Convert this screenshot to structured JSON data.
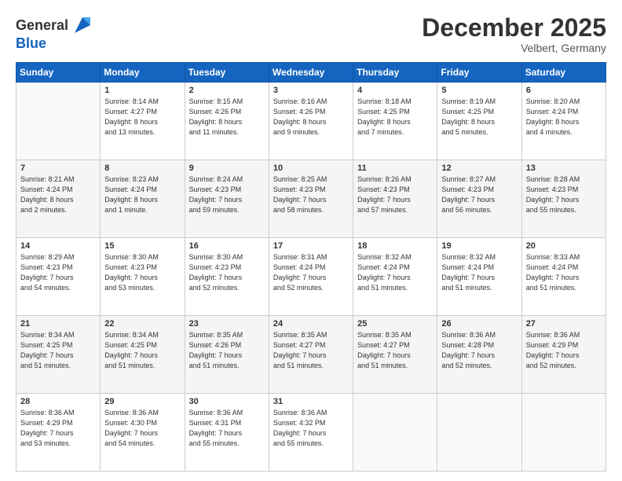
{
  "header": {
    "logo_general": "General",
    "logo_blue": "Blue",
    "month_title": "December 2025",
    "location": "Velbert, Germany"
  },
  "days_of_week": [
    "Sunday",
    "Monday",
    "Tuesday",
    "Wednesday",
    "Thursday",
    "Friday",
    "Saturday"
  ],
  "weeks": [
    [
      {
        "day": "",
        "info": ""
      },
      {
        "day": "1",
        "info": "Sunrise: 8:14 AM\nSunset: 4:27 PM\nDaylight: 8 hours\nand 13 minutes."
      },
      {
        "day": "2",
        "info": "Sunrise: 8:15 AM\nSunset: 4:26 PM\nDaylight: 8 hours\nand 11 minutes."
      },
      {
        "day": "3",
        "info": "Sunrise: 8:16 AM\nSunset: 4:26 PM\nDaylight: 8 hours\nand 9 minutes."
      },
      {
        "day": "4",
        "info": "Sunrise: 8:18 AM\nSunset: 4:25 PM\nDaylight: 8 hours\nand 7 minutes."
      },
      {
        "day": "5",
        "info": "Sunrise: 8:19 AM\nSunset: 4:25 PM\nDaylight: 8 hours\nand 5 minutes."
      },
      {
        "day": "6",
        "info": "Sunrise: 8:20 AM\nSunset: 4:24 PM\nDaylight: 8 hours\nand 4 minutes."
      }
    ],
    [
      {
        "day": "7",
        "info": "Sunrise: 8:21 AM\nSunset: 4:24 PM\nDaylight: 8 hours\nand 2 minutes."
      },
      {
        "day": "8",
        "info": "Sunrise: 8:23 AM\nSunset: 4:24 PM\nDaylight: 8 hours\nand 1 minute."
      },
      {
        "day": "9",
        "info": "Sunrise: 8:24 AM\nSunset: 4:23 PM\nDaylight: 7 hours\nand 59 minutes."
      },
      {
        "day": "10",
        "info": "Sunrise: 8:25 AM\nSunset: 4:23 PM\nDaylight: 7 hours\nand 58 minutes."
      },
      {
        "day": "11",
        "info": "Sunrise: 8:26 AM\nSunset: 4:23 PM\nDaylight: 7 hours\nand 57 minutes."
      },
      {
        "day": "12",
        "info": "Sunrise: 8:27 AM\nSunset: 4:23 PM\nDaylight: 7 hours\nand 56 minutes."
      },
      {
        "day": "13",
        "info": "Sunrise: 8:28 AM\nSunset: 4:23 PM\nDaylight: 7 hours\nand 55 minutes."
      }
    ],
    [
      {
        "day": "14",
        "info": "Sunrise: 8:29 AM\nSunset: 4:23 PM\nDaylight: 7 hours\nand 54 minutes."
      },
      {
        "day": "15",
        "info": "Sunrise: 8:30 AM\nSunset: 4:23 PM\nDaylight: 7 hours\nand 53 minutes."
      },
      {
        "day": "16",
        "info": "Sunrise: 8:30 AM\nSunset: 4:23 PM\nDaylight: 7 hours\nand 52 minutes."
      },
      {
        "day": "17",
        "info": "Sunrise: 8:31 AM\nSunset: 4:24 PM\nDaylight: 7 hours\nand 52 minutes."
      },
      {
        "day": "18",
        "info": "Sunrise: 8:32 AM\nSunset: 4:24 PM\nDaylight: 7 hours\nand 51 minutes."
      },
      {
        "day": "19",
        "info": "Sunrise: 8:32 AM\nSunset: 4:24 PM\nDaylight: 7 hours\nand 51 minutes."
      },
      {
        "day": "20",
        "info": "Sunrise: 8:33 AM\nSunset: 4:24 PM\nDaylight: 7 hours\nand 51 minutes."
      }
    ],
    [
      {
        "day": "21",
        "info": "Sunrise: 8:34 AM\nSunset: 4:25 PM\nDaylight: 7 hours\nand 51 minutes."
      },
      {
        "day": "22",
        "info": "Sunrise: 8:34 AM\nSunset: 4:25 PM\nDaylight: 7 hours\nand 51 minutes."
      },
      {
        "day": "23",
        "info": "Sunrise: 8:35 AM\nSunset: 4:26 PM\nDaylight: 7 hours\nand 51 minutes."
      },
      {
        "day": "24",
        "info": "Sunrise: 8:35 AM\nSunset: 4:27 PM\nDaylight: 7 hours\nand 51 minutes."
      },
      {
        "day": "25",
        "info": "Sunrise: 8:35 AM\nSunset: 4:27 PM\nDaylight: 7 hours\nand 51 minutes."
      },
      {
        "day": "26",
        "info": "Sunrise: 8:36 AM\nSunset: 4:28 PM\nDaylight: 7 hours\nand 52 minutes."
      },
      {
        "day": "27",
        "info": "Sunrise: 8:36 AM\nSunset: 4:29 PM\nDaylight: 7 hours\nand 52 minutes."
      }
    ],
    [
      {
        "day": "28",
        "info": "Sunrise: 8:36 AM\nSunset: 4:29 PM\nDaylight: 7 hours\nand 53 minutes."
      },
      {
        "day": "29",
        "info": "Sunrise: 8:36 AM\nSunset: 4:30 PM\nDaylight: 7 hours\nand 54 minutes."
      },
      {
        "day": "30",
        "info": "Sunrise: 8:36 AM\nSunset: 4:31 PM\nDaylight: 7 hours\nand 55 minutes."
      },
      {
        "day": "31",
        "info": "Sunrise: 8:36 AM\nSunset: 4:32 PM\nDaylight: 7 hours\nand 55 minutes."
      },
      {
        "day": "",
        "info": ""
      },
      {
        "day": "",
        "info": ""
      },
      {
        "day": "",
        "info": ""
      }
    ]
  ]
}
